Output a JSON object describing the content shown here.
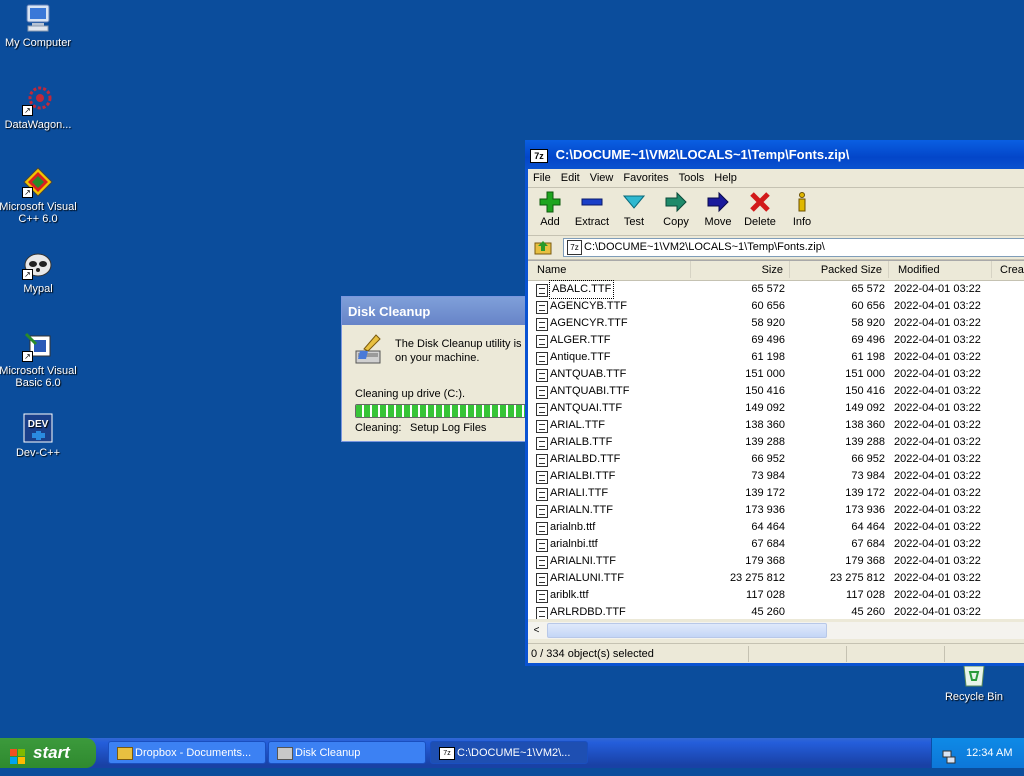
{
  "desktop": {
    "icons": [
      {
        "label": "My Computer"
      },
      {
        "label": "DataWagon..."
      },
      {
        "label": "Microsoft Visual C++ 6.0"
      },
      {
        "label": "Mypal"
      },
      {
        "label": "Microsoft Visual Basic 6.0"
      },
      {
        "label": "Dev-C++"
      },
      {
        "label": "Recycle Bin"
      }
    ]
  },
  "cleanup": {
    "title": "Disk Cleanup",
    "message": "The Disk Cleanup utility is c on your machine.",
    "drive_text": "Cleaning up drive  (C:).",
    "cleaning_label": "Cleaning:",
    "cleaning_item": "Setup Log Files",
    "progress": 1.0
  },
  "zip": {
    "title": "C:\\DOCUME~1\\VM2\\LOCALS~1\\Temp\\Fonts.zip\\",
    "menu": [
      "File",
      "Edit",
      "View",
      "Favorites",
      "Tools",
      "Help"
    ],
    "tools": [
      {
        "label": "Add",
        "icon": "plus-icon",
        "color": "#1fa51f"
      },
      {
        "label": "Extract",
        "icon": "minus-icon",
        "color": "#1a3fc8"
      },
      {
        "label": "Test",
        "icon": "check-icon",
        "color": "#2fb8d0"
      },
      {
        "label": "Copy",
        "icon": "copy-arrow-icon",
        "color": "#1e8a6a"
      },
      {
        "label": "Move",
        "icon": "move-arrow-icon",
        "color": "#1a1a9c"
      },
      {
        "label": "Delete",
        "icon": "x-icon",
        "color": "#d21a1a"
      },
      {
        "label": "Info",
        "icon": "info-icon",
        "color": "#e0b800"
      }
    ],
    "address": "C:\\DOCUME~1\\VM2\\LOCALS~1\\Temp\\Fonts.zip\\",
    "columns": [
      "Name",
      "Size",
      "Packed Size",
      "Modified",
      "Creat"
    ],
    "files": [
      {
        "name": "ABALC.TTF",
        "size": "65 572",
        "packed": "65 572",
        "modified": "2022-04-01 03:22"
      },
      {
        "name": "AGENCYB.TTF",
        "size": "60 656",
        "packed": "60 656",
        "modified": "2022-04-01 03:22"
      },
      {
        "name": "AGENCYR.TTF",
        "size": "58 920",
        "packed": "58 920",
        "modified": "2022-04-01 03:22"
      },
      {
        "name": "ALGER.TTF",
        "size": "69 496",
        "packed": "69 496",
        "modified": "2022-04-01 03:22"
      },
      {
        "name": "Antique.TTF",
        "size": "61 198",
        "packed": "61 198",
        "modified": "2022-04-01 03:22"
      },
      {
        "name": "ANTQUAB.TTF",
        "size": "151 000",
        "packed": "151 000",
        "modified": "2022-04-01 03:22"
      },
      {
        "name": "ANTQUABI.TTF",
        "size": "150 416",
        "packed": "150 416",
        "modified": "2022-04-01 03:22"
      },
      {
        "name": "ANTQUAI.TTF",
        "size": "149 092",
        "packed": "149 092",
        "modified": "2022-04-01 03:22"
      },
      {
        "name": "ARIAL.TTF",
        "size": "138 360",
        "packed": "138 360",
        "modified": "2022-04-01 03:22"
      },
      {
        "name": "ARIALB.TTF",
        "size": "139 288",
        "packed": "139 288",
        "modified": "2022-04-01 03:22"
      },
      {
        "name": "ARIALBD.TTF",
        "size": "66 952",
        "packed": "66 952",
        "modified": "2022-04-01 03:22"
      },
      {
        "name": "ARIALBI.TTF",
        "size": "73 984",
        "packed": "73 984",
        "modified": "2022-04-01 03:22"
      },
      {
        "name": "ARIALI.TTF",
        "size": "139 172",
        "packed": "139 172",
        "modified": "2022-04-01 03:22"
      },
      {
        "name": "ARIALN.TTF",
        "size": "173 936",
        "packed": "173 936",
        "modified": "2022-04-01 03:22"
      },
      {
        "name": "arialnb.ttf",
        "size": "64 464",
        "packed": "64 464",
        "modified": "2022-04-01 03:22"
      },
      {
        "name": "arialnbi.ttf",
        "size": "67 684",
        "packed": "67 684",
        "modified": "2022-04-01 03:22"
      },
      {
        "name": "ARIALNI.TTF",
        "size": "179 368",
        "packed": "179 368",
        "modified": "2022-04-01 03:22"
      },
      {
        "name": "ARIALUNI.TTF",
        "size": "23 275 812",
        "packed": "23 275 812",
        "modified": "2022-04-01 03:22"
      },
      {
        "name": "ariblk.ttf",
        "size": "117 028",
        "packed": "117 028",
        "modified": "2022-04-01 03:22"
      },
      {
        "name": "ARLRDBD.TTF",
        "size": "45 260",
        "packed": "45 260",
        "modified": "2022-04-01 03:22"
      }
    ],
    "status": "0 / 334 object(s) selected"
  },
  "taskbar": {
    "start_label": "start",
    "tasks": [
      {
        "label": "Dropbox - Documents..."
      },
      {
        "label": "Disk Cleanup"
      },
      {
        "label": "C:\\DOCUME~1\\VM2\\..."
      }
    ],
    "clock": "12:34 AM"
  }
}
